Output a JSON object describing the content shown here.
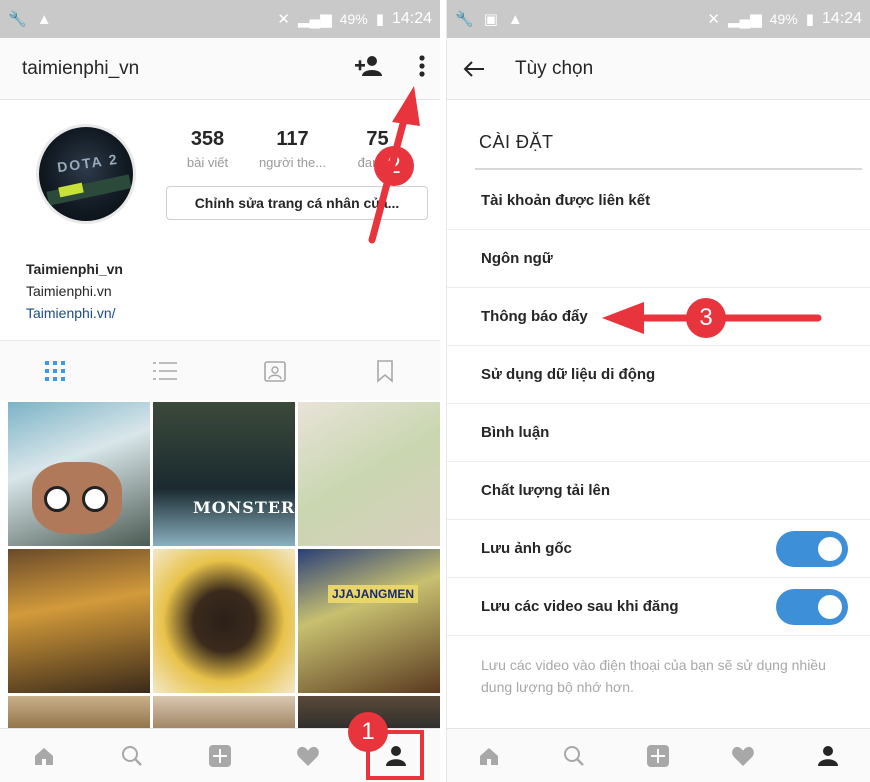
{
  "left": {
    "statusbar": {
      "battery": "49%",
      "time": "14:24"
    },
    "toolbar": {
      "title": "taimienphi_vn"
    },
    "stats": [
      {
        "num": "358",
        "label": "bài viết"
      },
      {
        "num": "117",
        "label": "người the..."
      },
      {
        "num": "75",
        "label": "đang..."
      }
    ],
    "edit_button": "Chỉnh sửa trang cá nhân của...",
    "avatar_text": "DOTA 2",
    "bio": {
      "name": "Taimienphi_vn",
      "line": "Taimienphi.vn",
      "link": "Taimienphi.vn/"
    },
    "tiles": {
      "monster": "MONSTER",
      "noodle": "JJAJANGMEN"
    }
  },
  "right": {
    "statusbar": {
      "battery": "49%",
      "time": "14:24"
    },
    "toolbar": {
      "title": "Tùy chọn"
    },
    "section": "CÀI ĐẶT",
    "items": [
      {
        "label": "Tài khoản được liên kết"
      },
      {
        "label": "Ngôn ngữ"
      },
      {
        "label": "Thông báo đẩy"
      },
      {
        "label": "Sử dụng dữ liệu di động"
      },
      {
        "label": "Bình luận"
      },
      {
        "label": "Chất lượng tải lên"
      },
      {
        "label": "Lưu ảnh gốc",
        "toggle": true
      },
      {
        "label": "Lưu các video sau khi đăng",
        "toggle": true
      }
    ],
    "note": "Lưu các video vào điện thoại của bạn sẽ sử dụng nhiều dung lượng bộ nhớ hơn."
  },
  "annotations": {
    "step1": "1",
    "step2": "2",
    "step3": "3"
  },
  "colors": {
    "annotation_red": "#e8343c",
    "toggle_blue": "#3d8fd8",
    "link_blue": "#1b4c86"
  },
  "icons": {
    "add_user": "add-person-icon",
    "more": "more-vertical-icon",
    "back": "back-arrow-icon",
    "nav": [
      "home-icon",
      "search-icon",
      "add-post-icon",
      "heart-icon",
      "profile-icon"
    ]
  }
}
